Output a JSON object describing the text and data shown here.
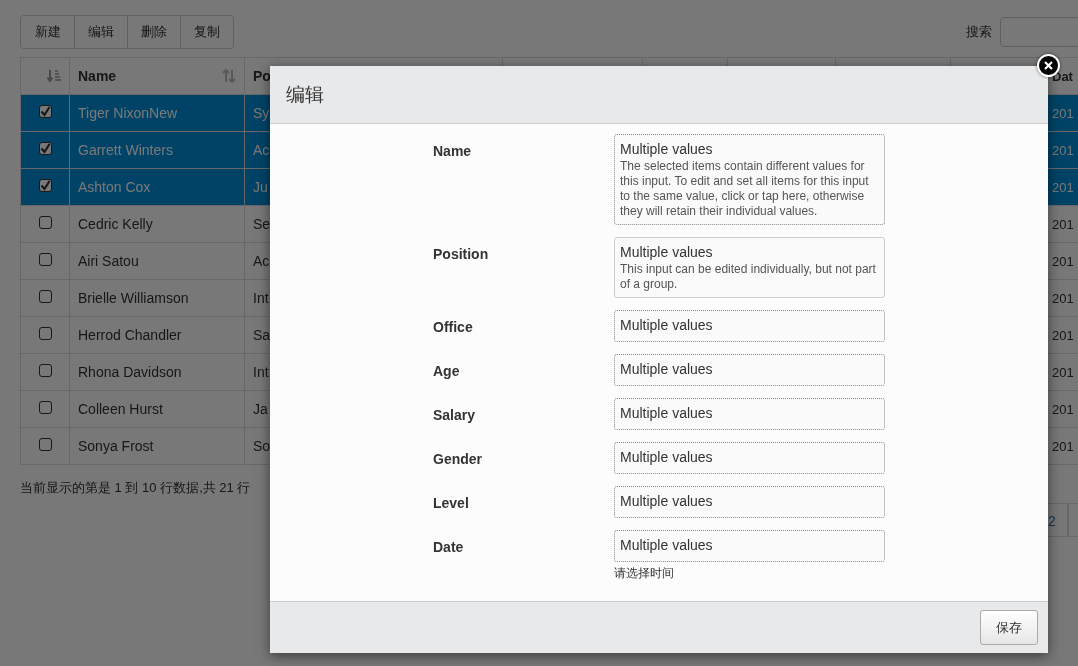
{
  "toolbar": {
    "buttons": [
      "新建",
      "编辑",
      "删除",
      "复制"
    ]
  },
  "search": {
    "label": "搜索"
  },
  "table": {
    "columns": [
      {
        "sortable": true
      },
      {
        "label": "Name",
        "sortable": true
      },
      {
        "label": "Po"
      },
      {
        "label": "Dat"
      }
    ],
    "rows": [
      {
        "selected": true,
        "checked": true,
        "name": "Tiger NixonNew",
        "position": "Sy",
        "date": "201"
      },
      {
        "selected": true,
        "checked": true,
        "name": "Garrett Winters",
        "position": "Ac",
        "date": "201"
      },
      {
        "selected": true,
        "checked": true,
        "name": "Ashton Cox",
        "position": "Ju",
        "date": "201"
      },
      {
        "selected": false,
        "checked": false,
        "name": "Cedric Kelly",
        "position": "Se",
        "date": "201"
      },
      {
        "selected": false,
        "checked": false,
        "name": "Airi Satou",
        "position": "Ac",
        "date": "201"
      },
      {
        "selected": false,
        "checked": false,
        "name": "Brielle Williamson",
        "position": "Int",
        "date": "201"
      },
      {
        "selected": false,
        "checked": false,
        "name": "Herrod Chandler",
        "position": "Sa",
        "date": "201"
      },
      {
        "selected": false,
        "checked": false,
        "name": "Rhona Davidson",
        "position": "Int",
        "date": "201"
      },
      {
        "selected": false,
        "checked": false,
        "name": "Colleen Hurst",
        "position": "Ja",
        "date": "201"
      },
      {
        "selected": false,
        "checked": false,
        "name": "Sonya Frost",
        "position": "So",
        "date": "201"
      }
    ]
  },
  "table_info": "当前显示的第是 1 到 10 行数据,共 21 行",
  "pagination": {
    "pages": [
      "2"
    ]
  },
  "modal": {
    "title": "编辑",
    "fields": [
      {
        "label": "Name",
        "kind": "multi",
        "value": "Multiple values",
        "note": "The selected items contain different values for this input. To edit and set all items for this input to the same value, click or tap here, otherwise they will retain their individual values."
      },
      {
        "label": "Position",
        "kind": "single",
        "value": "Multiple values",
        "note": "This input can be edited individually, but not part of a group."
      },
      {
        "label": "Office",
        "kind": "multi",
        "value": "Multiple values"
      },
      {
        "label": "Age",
        "kind": "multi",
        "value": "Multiple values"
      },
      {
        "label": "Salary",
        "kind": "multi",
        "value": "Multiple values"
      },
      {
        "label": "Gender",
        "kind": "multi",
        "value": "Multiple values"
      },
      {
        "label": "Level",
        "kind": "multi",
        "value": "Multiple values"
      },
      {
        "label": "Date",
        "kind": "multi",
        "value": "Multiple values",
        "hint": "请选择时间"
      }
    ],
    "save_button": "保存"
  }
}
